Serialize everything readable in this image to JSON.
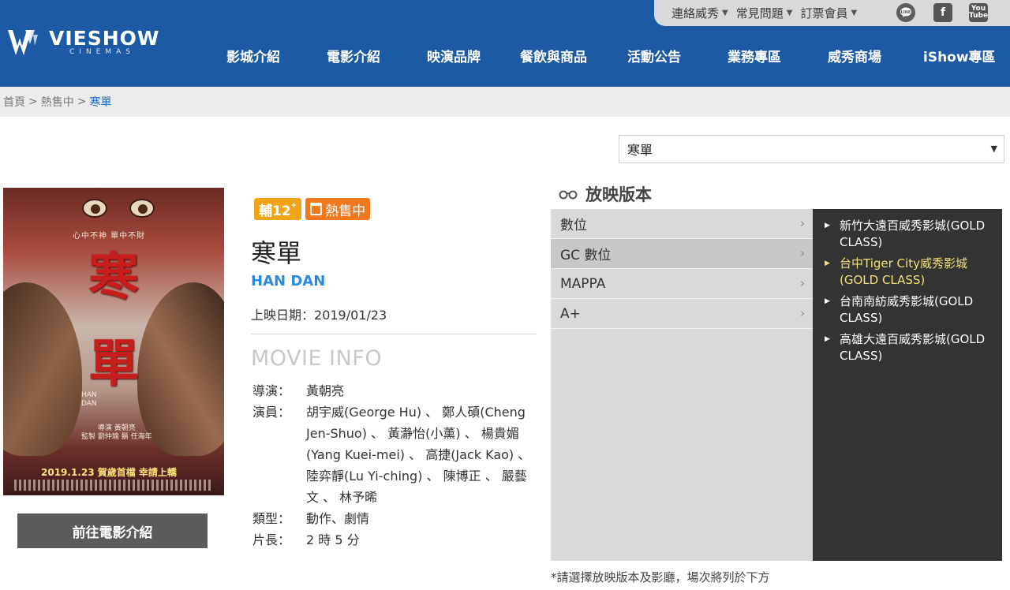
{
  "topbar": {
    "links": [
      {
        "label": "連絡威秀"
      },
      {
        "label": "常見問題"
      },
      {
        "label": "訂票會員"
      }
    ],
    "social": [
      "line-icon",
      "facebook-icon",
      "youtube-icon"
    ]
  },
  "logo": {
    "brand": "VIESHOW",
    "sub": "CINEMAS"
  },
  "nav": [
    {
      "label": "影城介紹"
    },
    {
      "label": "電影介紹"
    },
    {
      "label": "映演品牌"
    },
    {
      "label": "餐飲與商品"
    },
    {
      "label": "活動公告"
    },
    {
      "label": "業務專區"
    },
    {
      "label": "威秀商場"
    },
    {
      "label": "iShow專區"
    }
  ],
  "breadcrumb": {
    "home": "首頁",
    "sep": ">",
    "section": "熱售中",
    "current": "寒單"
  },
  "select": {
    "value": "寒單"
  },
  "poster": {
    "tagline": "心中不神 單中不財",
    "title_chars": [
      "寒",
      "單"
    ],
    "en": "HAN\nDAN",
    "credits_line": "導演 黃朝亮\n監製 劉仲瑜 鬍 任海年",
    "date_line": "2019.1.23  賀歲首檔  幸請上轎"
  },
  "goto_button": "前往電影介紹",
  "badges": {
    "rating": "輔12",
    "rating_sup": "+",
    "sale": "熱售中"
  },
  "movie": {
    "title": "寒單",
    "title_en": "HAN DAN",
    "release_label": "上映日期：",
    "release_date": "2019/01/23",
    "info_heading": "MOVIE INFO",
    "rows": [
      {
        "k": "導演：",
        "v": "黃朝亮"
      },
      {
        "k": "演員：",
        "v": "胡宇威(George Hu) 、 鄭人碩(Cheng Jen-Shuo) 、 黃瀞怡(小薰) 、 楊貴媚(Yang Kuei-mei) 、 高捷(Jack Kao) 、 陸弈靜(Lu Yi-ching) 、 陳博正 、 嚴藝文 、 林予晞"
      },
      {
        "k": "類型：",
        "v": "動作、劇情"
      },
      {
        "k": "片長：",
        "v": "2 時 5 分"
      }
    ]
  },
  "versions": {
    "heading": "放映版本",
    "items": [
      {
        "label": "數位"
      },
      {
        "label": "GC 數位"
      },
      {
        "label": "MAPPA"
      },
      {
        "label": "A+"
      }
    ],
    "selected_index": 1
  },
  "cinemas": [
    {
      "label": "新竹大遠百威秀影城(GOLD CLASS)"
    },
    {
      "label": "台中Tiger City威秀影城(GOLD CLASS)"
    },
    {
      "label": "台南南紡威秀影城(GOLD CLASS)"
    },
    {
      "label": "高雄大遠百威秀影城(GOLD CLASS)"
    }
  ],
  "note": "*請選擇放映版本及影廳，場次將列於下方",
  "colors": {
    "header": "#1c5aa6",
    "accent_blue": "#2b8be0",
    "rating": "#f0a416",
    "sale": "#f4791e",
    "highlight": "#f4e07a"
  }
}
